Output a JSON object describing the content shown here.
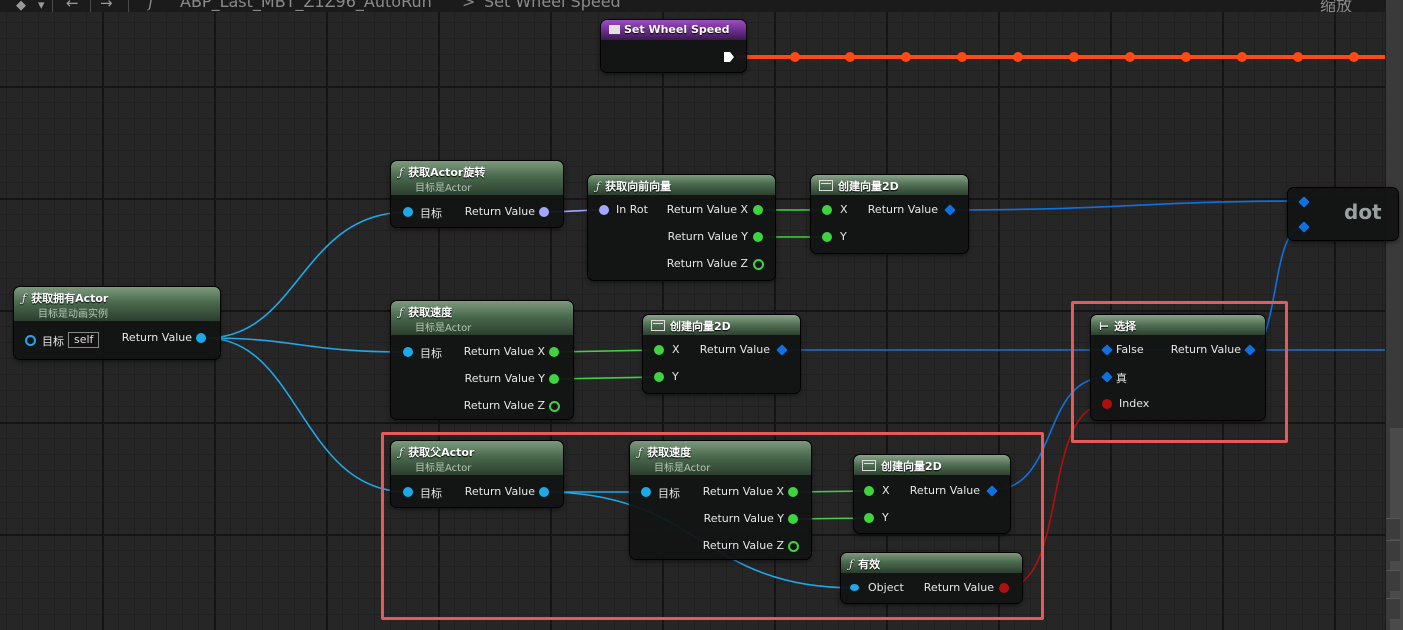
{
  "topbar": {
    "breadcrumb_function_icon": "f",
    "breadcrumb_path": "ABP_Last_MBT_Z1Z96_AutoRun",
    "breadcrumb_sep": ">",
    "breadcrumb_current": "Set Wheel Speed",
    "zoom_label": "缩放"
  },
  "nodes": {
    "set_wheel_speed": {
      "title": "Set Wheel Speed"
    },
    "get_owning_actor": {
      "title": "获取拥有Actor",
      "subtitle": "目标是动画实例",
      "target_label": "目标",
      "self_value": "self",
      "return_label": "Return Value"
    },
    "get_actor_rotation": {
      "title": "获取Actor旋转",
      "subtitle": "目标是Actor",
      "target_label": "目标",
      "return_label": "Return Value"
    },
    "get_forward_vector": {
      "title": "获取向前向量",
      "in_label": "In Rot",
      "rx": "Return Value X",
      "ry": "Return Value Y",
      "rz": "Return Value Z"
    },
    "make_vector2d_1": {
      "title": "创建向量2D",
      "x": "X",
      "y": "Y",
      "return_label": "Return Value"
    },
    "dot": {
      "title": "dot"
    },
    "get_velocity_1": {
      "title": "获取速度",
      "subtitle": "目标是Actor",
      "target_label": "目标",
      "rx": "Return Value X",
      "ry": "Return Value Y",
      "rz": "Return Value Z"
    },
    "make_vector2d_2": {
      "title": "创建向量2D",
      "x": "X",
      "y": "Y",
      "return_label": "Return Value"
    },
    "select": {
      "title": "选择",
      "false_label": "False",
      "true_label": "真",
      "index_label": "Index",
      "return_label": "Return Value"
    },
    "get_parent_actor": {
      "title": "获取父Actor",
      "subtitle": "目标是Actor",
      "target_label": "目标",
      "return_label": "Return Value"
    },
    "get_velocity_2": {
      "title": "获取速度",
      "subtitle": "目标是Actor",
      "target_label": "目标",
      "rx": "Return Value X",
      "ry": "Return Value Y",
      "rz": "Return Value Z"
    },
    "make_vector2d_3": {
      "title": "创建向量2D",
      "x": "X",
      "y": "Y",
      "return_label": "Return Value"
    },
    "is_valid": {
      "title": "有效",
      "object_label": "Object",
      "return_label": "Return Value"
    }
  },
  "colors": {
    "exec_wire": "#ff4a14",
    "object_wire": "#1fa8e8",
    "float_wire": "#3fd33f",
    "vector2d_wire": "#1070e0",
    "rotator_wire": "#a3a6ff",
    "bool_wire": "#b10f0f",
    "highlight": "#e55a5a",
    "function_header": "#4a6a4e",
    "event_header": "#6b2b8c"
  },
  "icons": [
    "function-icon",
    "make-struct-icon",
    "select-icon",
    "event-icon",
    "exec-pin-icon"
  ]
}
